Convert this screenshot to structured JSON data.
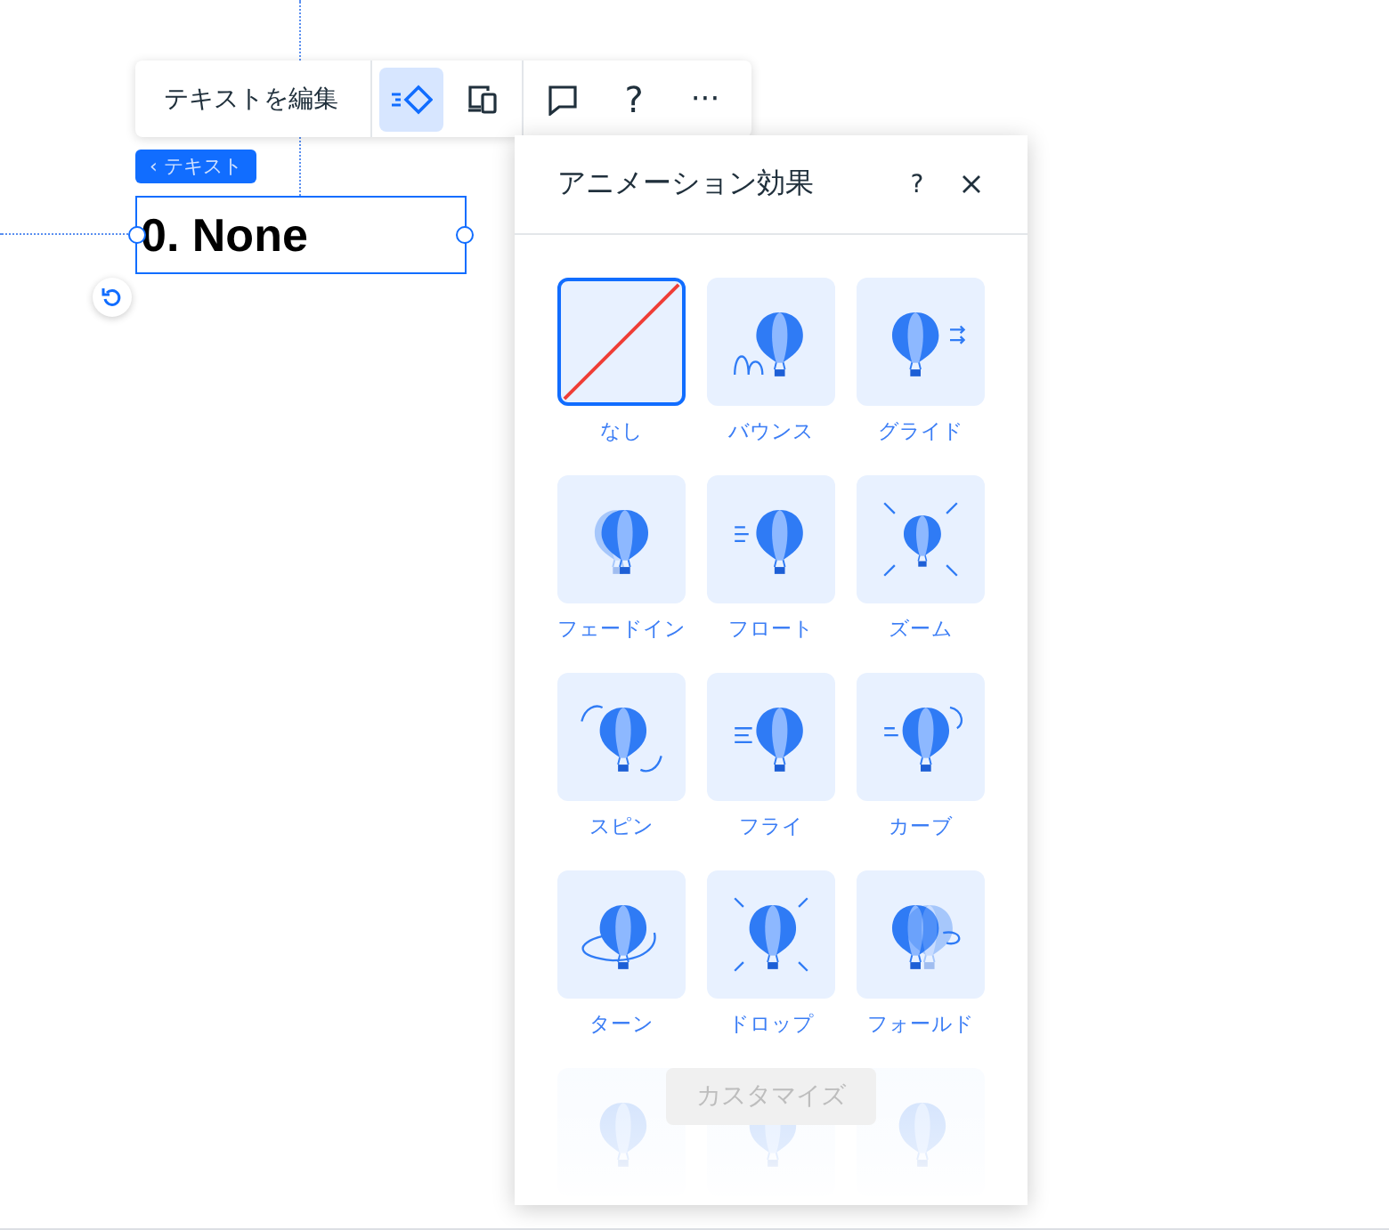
{
  "toolbar": {
    "edit_text": "テキストを編集",
    "tools": [
      {
        "kind": "animation",
        "selected": true
      },
      {
        "kind": "devices",
        "selected": false
      },
      {
        "kind": "comment",
        "selected": false
      },
      {
        "kind": "help",
        "label": "?",
        "selected": false
      },
      {
        "kind": "more",
        "label": "···",
        "selected": false
      }
    ]
  },
  "element": {
    "tag": "‹ テキスト",
    "text": "0. None"
  },
  "panel": {
    "title": "アニメーション効果",
    "help": "?",
    "tiles": [
      {
        "kind": "none",
        "label": "なし",
        "selected": true
      },
      {
        "kind": "bounce",
        "label": "バウンス",
        "selected": false
      },
      {
        "kind": "glide",
        "label": "グライド",
        "selected": false
      },
      {
        "kind": "fade",
        "label": "フェードイン",
        "selected": false
      },
      {
        "kind": "float",
        "label": "フロート",
        "selected": false
      },
      {
        "kind": "zoom",
        "label": "ズーム",
        "selected": false
      },
      {
        "kind": "spin",
        "label": "スピン",
        "selected": false
      },
      {
        "kind": "fly",
        "label": "フライ",
        "selected": false
      },
      {
        "kind": "curve",
        "label": "カーブ",
        "selected": false
      },
      {
        "kind": "turn",
        "label": "ターン",
        "selected": false
      },
      {
        "kind": "drop",
        "label": "ドロップ",
        "selected": false
      },
      {
        "kind": "fold",
        "label": "フォールド",
        "selected": false
      },
      {
        "kind": "faded",
        "selected": false
      },
      {
        "kind": "faded",
        "selected": false
      },
      {
        "kind": "faded",
        "selected": false
      }
    ],
    "customize": {
      "label": "カスタマイズ",
      "disabled": true
    }
  }
}
